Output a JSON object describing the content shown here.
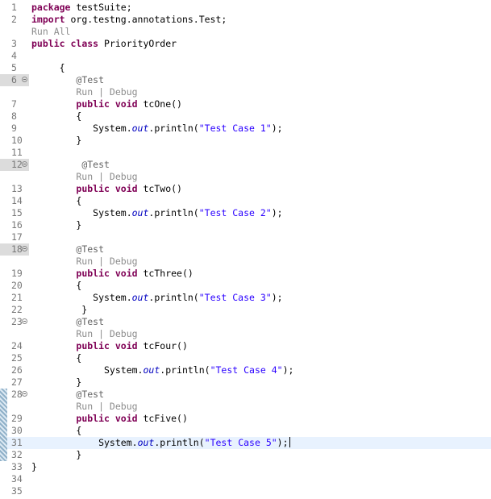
{
  "editor": {
    "lines": [
      {
        "ln": "1",
        "segments": [
          {
            "t": "package",
            "c": "kw"
          },
          {
            "t": " testSuite;",
            "c": ""
          }
        ]
      },
      {
        "ln": "2",
        "segments": [
          {
            "t": "import",
            "c": "kw"
          },
          {
            "t": " org.testng.annotations.Test;",
            "c": ""
          }
        ]
      },
      {
        "ln": "",
        "lens": true,
        "segments": [
          {
            "t": "Run All",
            "c": "lens"
          }
        ]
      },
      {
        "ln": "3",
        "segments": [
          {
            "t": "public",
            "c": "kw"
          },
          {
            "t": " ",
            "c": ""
          },
          {
            "t": "class",
            "c": "kw"
          },
          {
            "t": " PriorityOrder",
            "c": ""
          }
        ]
      },
      {
        "ln": "4",
        "segments": []
      },
      {
        "ln": "5",
        "segments": [
          {
            "t": "     {",
            "c": ""
          }
        ]
      },
      {
        "ln": "6",
        "fold": true,
        "selected": true,
        "segments": [
          {
            "t": "        ",
            "c": ""
          },
          {
            "t": "@Test",
            "c": "ann"
          }
        ]
      },
      {
        "ln": "",
        "lens": true,
        "segments": [
          {
            "t": "        Run | Debug",
            "c": "lens"
          }
        ]
      },
      {
        "ln": "7",
        "segments": [
          {
            "t": "        ",
            "c": ""
          },
          {
            "t": "public",
            "c": "kw"
          },
          {
            "t": " ",
            "c": ""
          },
          {
            "t": "void",
            "c": "kw"
          },
          {
            "t": " tcOne()",
            "c": ""
          }
        ]
      },
      {
        "ln": "8",
        "segments": [
          {
            "t": "        {",
            "c": ""
          }
        ]
      },
      {
        "ln": "9",
        "segments": [
          {
            "t": "           System.",
            "c": ""
          },
          {
            "t": "out",
            "c": "fld"
          },
          {
            "t": ".println(",
            "c": ""
          },
          {
            "t": "\"Test Case 1\"",
            "c": "str"
          },
          {
            "t": ");",
            "c": ""
          }
        ]
      },
      {
        "ln": "10",
        "segments": [
          {
            "t": "        }",
            "c": ""
          }
        ]
      },
      {
        "ln": "11",
        "segments": []
      },
      {
        "ln": "12",
        "fold": true,
        "selected": true,
        "segments": [
          {
            "t": "         ",
            "c": ""
          },
          {
            "t": "@Test",
            "c": "ann"
          }
        ]
      },
      {
        "ln": "",
        "lens": true,
        "segments": [
          {
            "t": "        Run | Debug",
            "c": "lens"
          }
        ]
      },
      {
        "ln": "13",
        "segments": [
          {
            "t": "        ",
            "c": ""
          },
          {
            "t": "public",
            "c": "kw"
          },
          {
            "t": " ",
            "c": ""
          },
          {
            "t": "void",
            "c": "kw"
          },
          {
            "t": " tcTwo()",
            "c": ""
          }
        ]
      },
      {
        "ln": "14",
        "segments": [
          {
            "t": "        {",
            "c": ""
          }
        ]
      },
      {
        "ln": "15",
        "segments": [
          {
            "t": "           System.",
            "c": ""
          },
          {
            "t": "out",
            "c": "fld"
          },
          {
            "t": ".println(",
            "c": ""
          },
          {
            "t": "\"Test Case 2\"",
            "c": "str"
          },
          {
            "t": ");",
            "c": ""
          }
        ]
      },
      {
        "ln": "16",
        "segments": [
          {
            "t": "        }",
            "c": ""
          }
        ]
      },
      {
        "ln": "17",
        "segments": []
      },
      {
        "ln": "18",
        "fold": true,
        "selected": true,
        "segments": [
          {
            "t": "        ",
            "c": ""
          },
          {
            "t": "@Test",
            "c": "ann"
          }
        ]
      },
      {
        "ln": "",
        "lens": true,
        "segments": [
          {
            "t": "        Run | Debug",
            "c": "lens"
          }
        ]
      },
      {
        "ln": "19",
        "segments": [
          {
            "t": "        ",
            "c": ""
          },
          {
            "t": "public",
            "c": "kw"
          },
          {
            "t": " ",
            "c": ""
          },
          {
            "t": "void",
            "c": "kw"
          },
          {
            "t": " tcThree()",
            "c": ""
          }
        ]
      },
      {
        "ln": "20",
        "segments": [
          {
            "t": "        {",
            "c": ""
          }
        ]
      },
      {
        "ln": "21",
        "segments": [
          {
            "t": "           System.",
            "c": ""
          },
          {
            "t": "out",
            "c": "fld"
          },
          {
            "t": ".println(",
            "c": ""
          },
          {
            "t": "\"Test Case 3\"",
            "c": "str"
          },
          {
            "t": ");",
            "c": ""
          }
        ]
      },
      {
        "ln": "22",
        "segments": [
          {
            "t": "         }",
            "c": ""
          }
        ]
      },
      {
        "ln": "23",
        "fold": true,
        "segments": [
          {
            "t": "        ",
            "c": ""
          },
          {
            "t": "@Test",
            "c": "ann"
          }
        ]
      },
      {
        "ln": "",
        "lens": true,
        "segments": [
          {
            "t": "        Run | Debug",
            "c": "lens"
          }
        ]
      },
      {
        "ln": "24",
        "segments": [
          {
            "t": "        ",
            "c": ""
          },
          {
            "t": "public",
            "c": "kw"
          },
          {
            "t": " ",
            "c": ""
          },
          {
            "t": "void",
            "c": "kw"
          },
          {
            "t": " tcFour()",
            "c": ""
          }
        ]
      },
      {
        "ln": "25",
        "segments": [
          {
            "t": "        {",
            "c": ""
          }
        ]
      },
      {
        "ln": "26",
        "segments": [
          {
            "t": "             System.",
            "c": ""
          },
          {
            "t": "out",
            "c": "fld"
          },
          {
            "t": ".println(",
            "c": ""
          },
          {
            "t": "\"Test Case 4\"",
            "c": "str"
          },
          {
            "t": ");",
            "c": ""
          }
        ]
      },
      {
        "ln": "27",
        "segments": [
          {
            "t": "        }",
            "c": ""
          }
        ]
      },
      {
        "ln": "28",
        "fold": true,
        "segments": [
          {
            "t": "        ",
            "c": ""
          },
          {
            "t": "@Test",
            "c": "ann"
          }
        ]
      },
      {
        "ln": "",
        "lens": true,
        "segments": [
          {
            "t": "        Run | Debug",
            "c": "lens"
          }
        ]
      },
      {
        "ln": "29",
        "segments": [
          {
            "t": "        ",
            "c": ""
          },
          {
            "t": "public",
            "c": "kw"
          },
          {
            "t": " ",
            "c": ""
          },
          {
            "t": "void",
            "c": "kw"
          },
          {
            "t": " tcFive()",
            "c": ""
          }
        ]
      },
      {
        "ln": "30",
        "segments": [
          {
            "t": "        {",
            "c": ""
          }
        ]
      },
      {
        "ln": "31",
        "current": true,
        "caret": true,
        "segments": [
          {
            "t": "            System.",
            "c": ""
          },
          {
            "t": "out",
            "c": "fld"
          },
          {
            "t": ".println(",
            "c": ""
          },
          {
            "t": "\"Test Case 5\"",
            "c": "str"
          },
          {
            "t": ");",
            "c": ""
          }
        ]
      },
      {
        "ln": "32",
        "segments": [
          {
            "t": "        }",
            "c": ""
          }
        ]
      },
      {
        "ln": "33",
        "segments": [
          {
            "t": "}",
            "c": ""
          }
        ]
      },
      {
        "ln": "34",
        "segments": []
      },
      {
        "ln": "35",
        "segments": []
      }
    ]
  }
}
